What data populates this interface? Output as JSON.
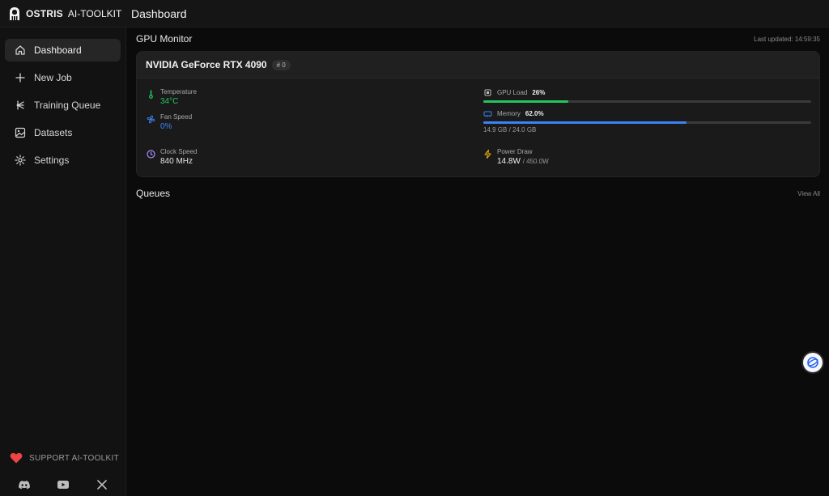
{
  "brand": {
    "name": "OSTRIS",
    "sub": "AI-TOOLKIT"
  },
  "header": {
    "title": "Dashboard"
  },
  "sidebar": {
    "items": [
      {
        "label": "Dashboard",
        "icon": "home-icon",
        "active": true
      },
      {
        "label": "New Job",
        "icon": "plus-icon"
      },
      {
        "label": "Training Queue",
        "icon": "queue-icon"
      },
      {
        "label": "Datasets",
        "icon": "images-icon"
      },
      {
        "label": "Settings",
        "icon": "gear-icon"
      }
    ],
    "support_label": "SUPPORT AI-TOOLKIT",
    "socials": [
      "discord-icon",
      "youtube-icon",
      "x-icon"
    ]
  },
  "gpu_monitor": {
    "title": "GPU Monitor",
    "last_updated": "Last updated: 14:59:35",
    "gpu": {
      "name": "NVIDIA GeForce RTX 4090",
      "badge": "# 0",
      "temperature": {
        "label": "Temperature",
        "value": "34°C"
      },
      "fan_speed": {
        "label": "Fan Speed",
        "value": "0%"
      },
      "clock_speed": {
        "label": "Clock Speed",
        "value": "840 MHz"
      },
      "gpu_load": {
        "label": "GPU Load",
        "value": "26%",
        "fraction": 0.26
      },
      "memory": {
        "label": "Memory",
        "value": "62.0%",
        "fraction": 0.62,
        "detail": "14.9 GB / 24.0 GB"
      },
      "power_draw": {
        "label": "Power Draw",
        "value": "14.8W",
        "max": "/ 450.0W"
      }
    }
  },
  "queues": {
    "title": "Queues",
    "view_all": "View All"
  },
  "colors": {
    "green": "#22c55e",
    "blue": "#3b82f6",
    "purple": "#a78bfa",
    "yellow": "#eab308",
    "heart": "#ef4444"
  }
}
